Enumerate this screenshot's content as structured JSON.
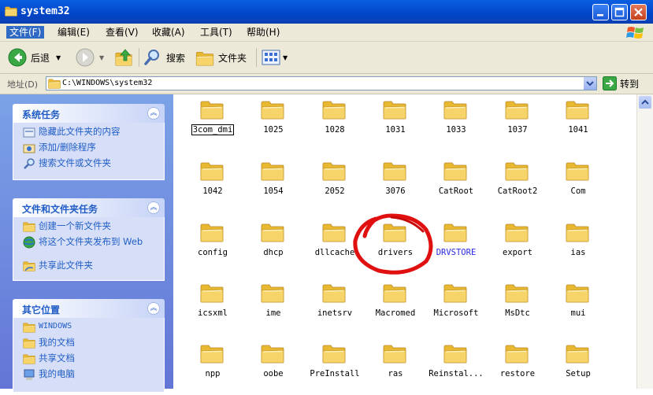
{
  "window": {
    "title": "system32"
  },
  "menu": [
    {
      "label": "文件(F)"
    },
    {
      "label": "编辑(E)"
    },
    {
      "label": "查看(V)"
    },
    {
      "label": "收藏(A)"
    },
    {
      "label": "工具(T)"
    },
    {
      "label": "帮助(H)"
    }
  ],
  "toolbar": {
    "back_label": "后退",
    "search_label": "搜索",
    "folders_label": "文件夹"
  },
  "address": {
    "label": "地址(D)",
    "value": "C:\\WINDOWS\\system32",
    "go_label": "转到"
  },
  "sidebar": {
    "system_tasks": {
      "title": "系统任务",
      "items": [
        "隐藏此文件夹的内容",
        "添加/删除程序",
        "搜索文件或文件夹"
      ]
    },
    "file_tasks": {
      "title": "文件和文件夹任务",
      "items": [
        "创建一个新文件夹",
        "将这个文件夹发布到 Web",
        "共享此文件夹"
      ]
    },
    "other_places": {
      "title": "其它位置",
      "items": [
        "WINDOWS",
        "我的文档",
        "共享文档",
        "我的电脑"
      ]
    }
  },
  "files": [
    "3com_dmi",
    "1025",
    "1028",
    "1031",
    "1033",
    "1037",
    "1041",
    "1042",
    "1054",
    "2052",
    "3076",
    "CatRoot",
    "CatRoot2",
    "Com",
    "config",
    "dhcp",
    "dllcache",
    "drivers",
    "DRVSTORE",
    "export",
    "ias",
    "icsxml",
    "ime",
    "inetsrv",
    "Macromed",
    "Microsoft",
    "MsDtc",
    "mui",
    "npp",
    "oobe",
    "PreInstall",
    "ras",
    "Reinstal...",
    "restore",
    "Setup"
  ],
  "colors": {
    "folder": "#f7d46a",
    "highlight_circle": "#e01010",
    "sidebar_link": "#215dc6",
    "active_menu": "#316ac5"
  }
}
